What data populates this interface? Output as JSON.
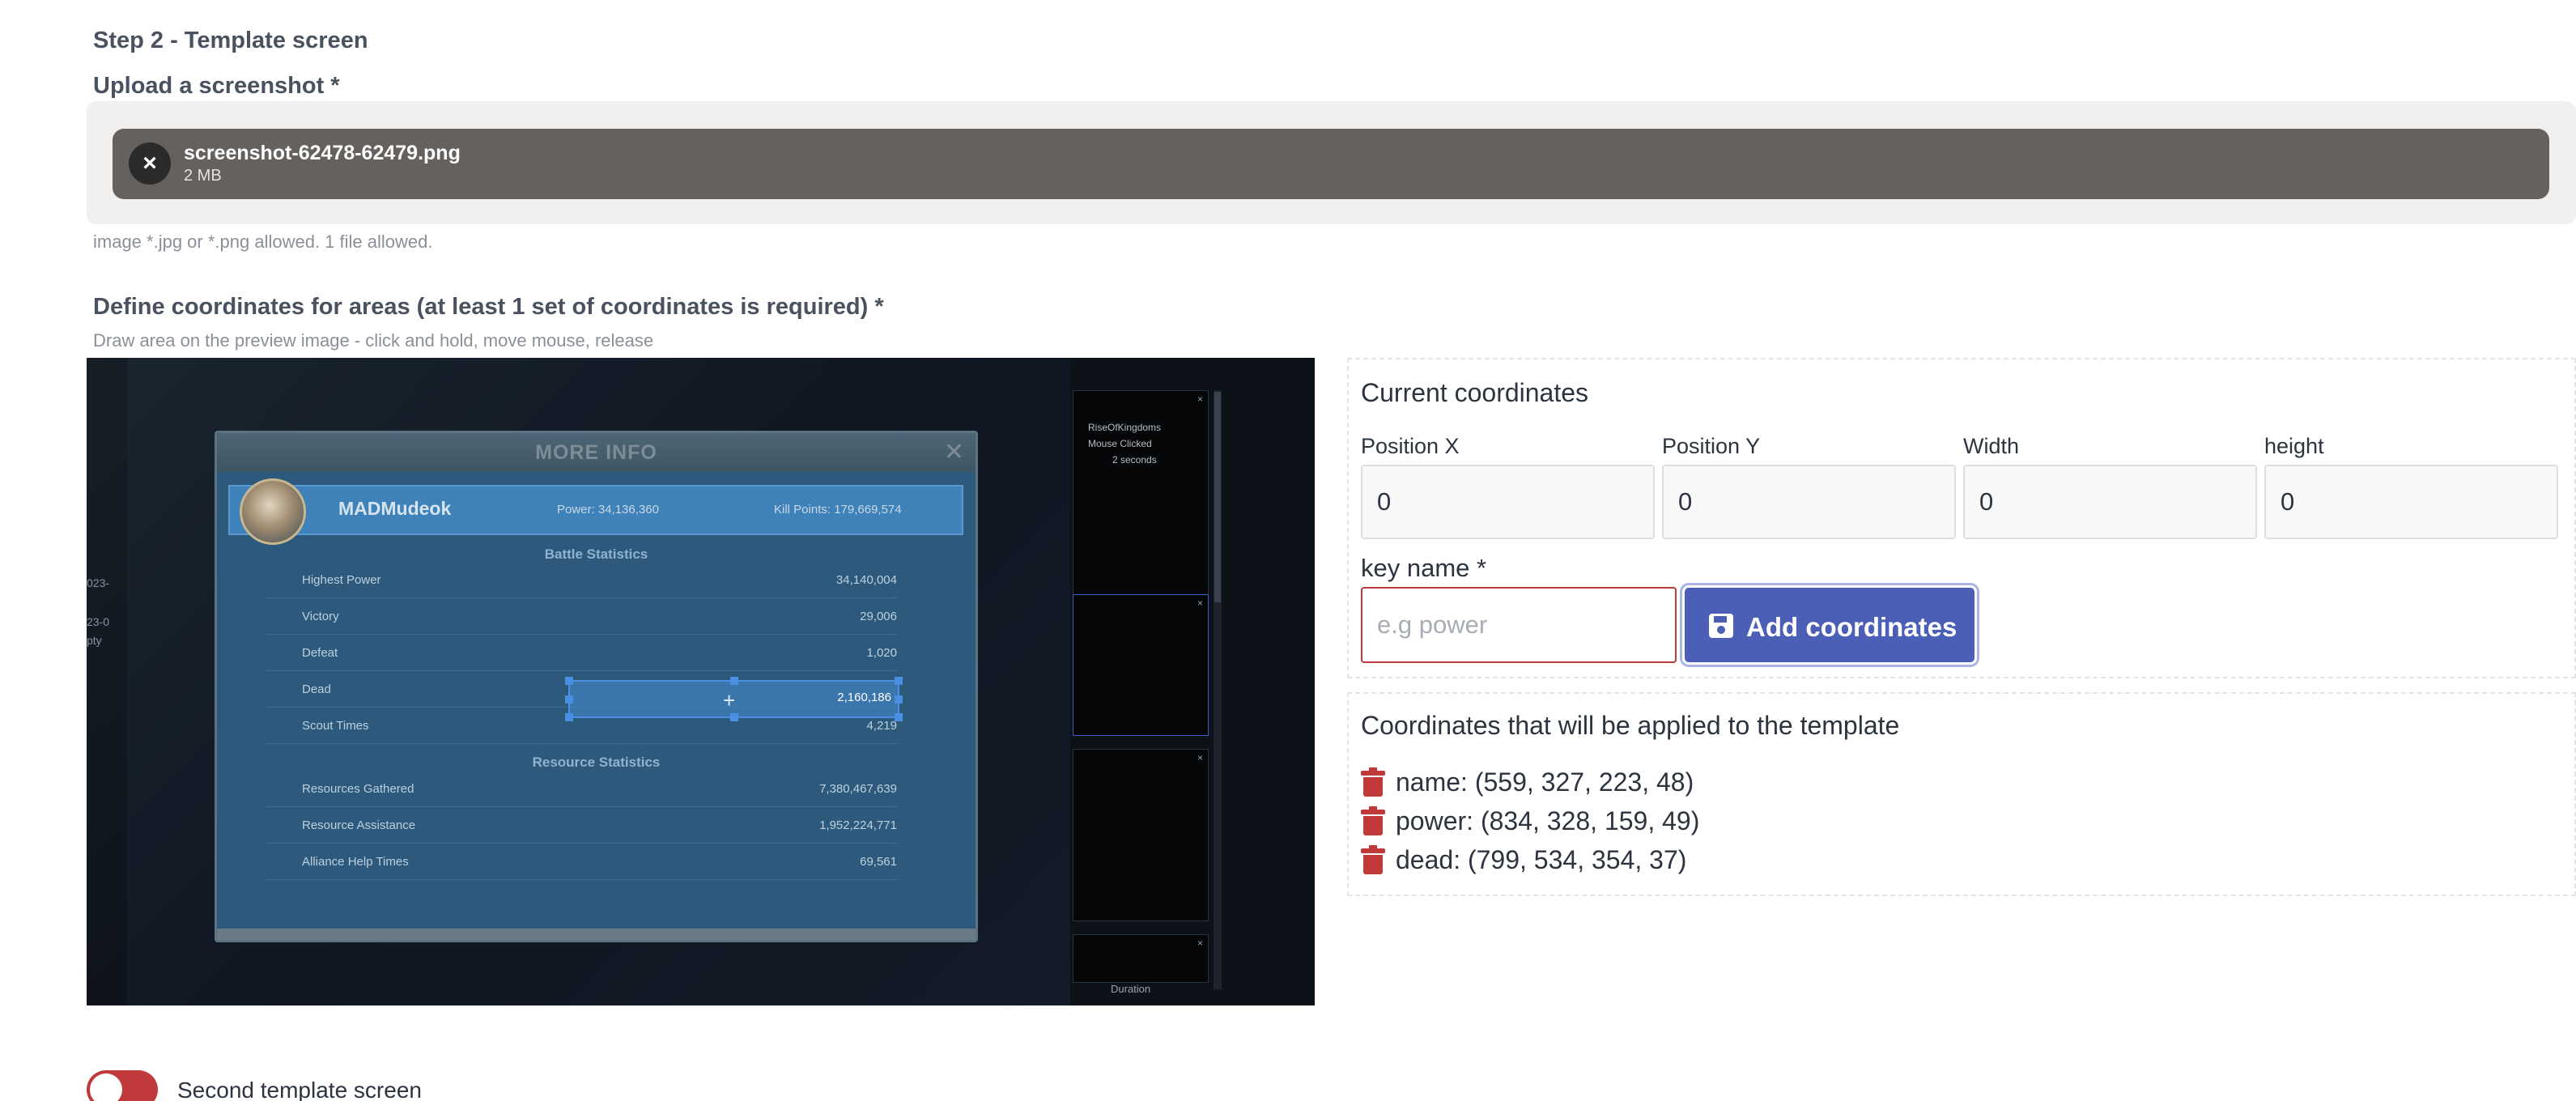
{
  "step_title": "Step 2 - Template screen",
  "upload": {
    "label": "Upload a screenshot *",
    "file_name": "screenshot-62478-62479.png",
    "file_size": "2 MB",
    "remove_glyph": "×",
    "hint": "image *.jpg or *.png allowed. 1 file allowed."
  },
  "coordinates_section": {
    "title": "Define coordinates for areas (at least 1 set of coordinates is required) *",
    "hint": "Draw area on the preview image - click and hold, move mouse, release"
  },
  "preview": {
    "dialog_title": "MORE INFO",
    "player_name": "MADMudeok",
    "power": "Power: 34,136,360",
    "kill_points": "Kill Points: 179,669,574",
    "battle_title": "Battle Statistics",
    "resource_title": "Resource Statistics",
    "battle_stats": [
      {
        "label": "Highest Power",
        "value": "34,140,004"
      },
      {
        "label": "Victory",
        "value": "29,006"
      },
      {
        "label": "Defeat",
        "value": "1,020"
      },
      {
        "label": "Dead",
        "value": "2,160,186"
      },
      {
        "label": "Scout Times",
        "value": "4,219"
      }
    ],
    "resource_stats": [
      {
        "label": "Resources Gathered",
        "value": "7,380,467,639"
      },
      {
        "label": "Resource Assistance",
        "value": "1,952,224,771"
      },
      {
        "label": "Alliance Help Times",
        "value": "69,561"
      }
    ],
    "side_panel": {
      "line1": "RiseOfKingdoms",
      "line2": "Mouse Clicked",
      "line3": "2 seconds",
      "duration": "Duration"
    },
    "left_texts": [
      "023-",
      "23-0",
      "pty"
    ]
  },
  "current_coordinates": {
    "title": "Current coordinates",
    "fields": [
      {
        "label": "Position X",
        "value": "0"
      },
      {
        "label": "Position Y",
        "value": "0"
      },
      {
        "label": "Width",
        "value": "0"
      },
      {
        "label": "height",
        "value": "0"
      }
    ],
    "key_label": "key name *",
    "key_placeholder": "e.g power",
    "add_button": "Add coordinates"
  },
  "applied": {
    "title": "Coordinates that will be applied to the template",
    "items": [
      "name: (559, 327, 223, 48)",
      "power: (834, 328, 159, 49)",
      "dead: (799, 534, 354, 37)"
    ]
  },
  "second_template": {
    "label": "Second template screen",
    "enabled": false
  },
  "colors": {
    "primary": "#4a5fb5",
    "danger": "#c0393b",
    "file_bar": "#64615f"
  }
}
